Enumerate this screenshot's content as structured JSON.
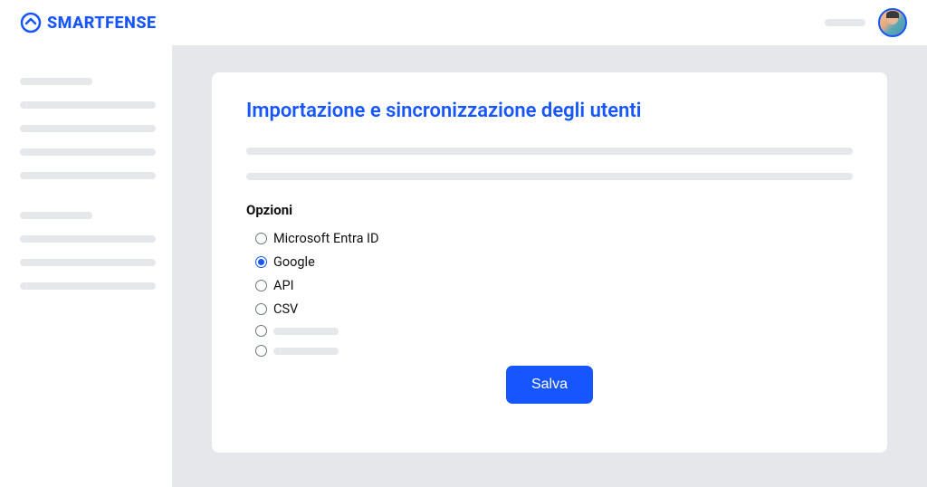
{
  "brand": {
    "name": "SMARTFENSE"
  },
  "card": {
    "title": "Importazione e sincronizzazione degli utenti",
    "options_label": "Opzioni",
    "options": [
      {
        "label": "Microsoft Entra ID",
        "selected": false,
        "placeholder": false
      },
      {
        "label": "Google",
        "selected": true,
        "placeholder": false
      },
      {
        "label": "API",
        "selected": false,
        "placeholder": false
      },
      {
        "label": "CSV",
        "selected": false,
        "placeholder": false
      },
      {
        "label": "",
        "selected": false,
        "placeholder": true
      },
      {
        "label": "",
        "selected": false,
        "placeholder": true
      }
    ],
    "save_label": "Salva"
  }
}
